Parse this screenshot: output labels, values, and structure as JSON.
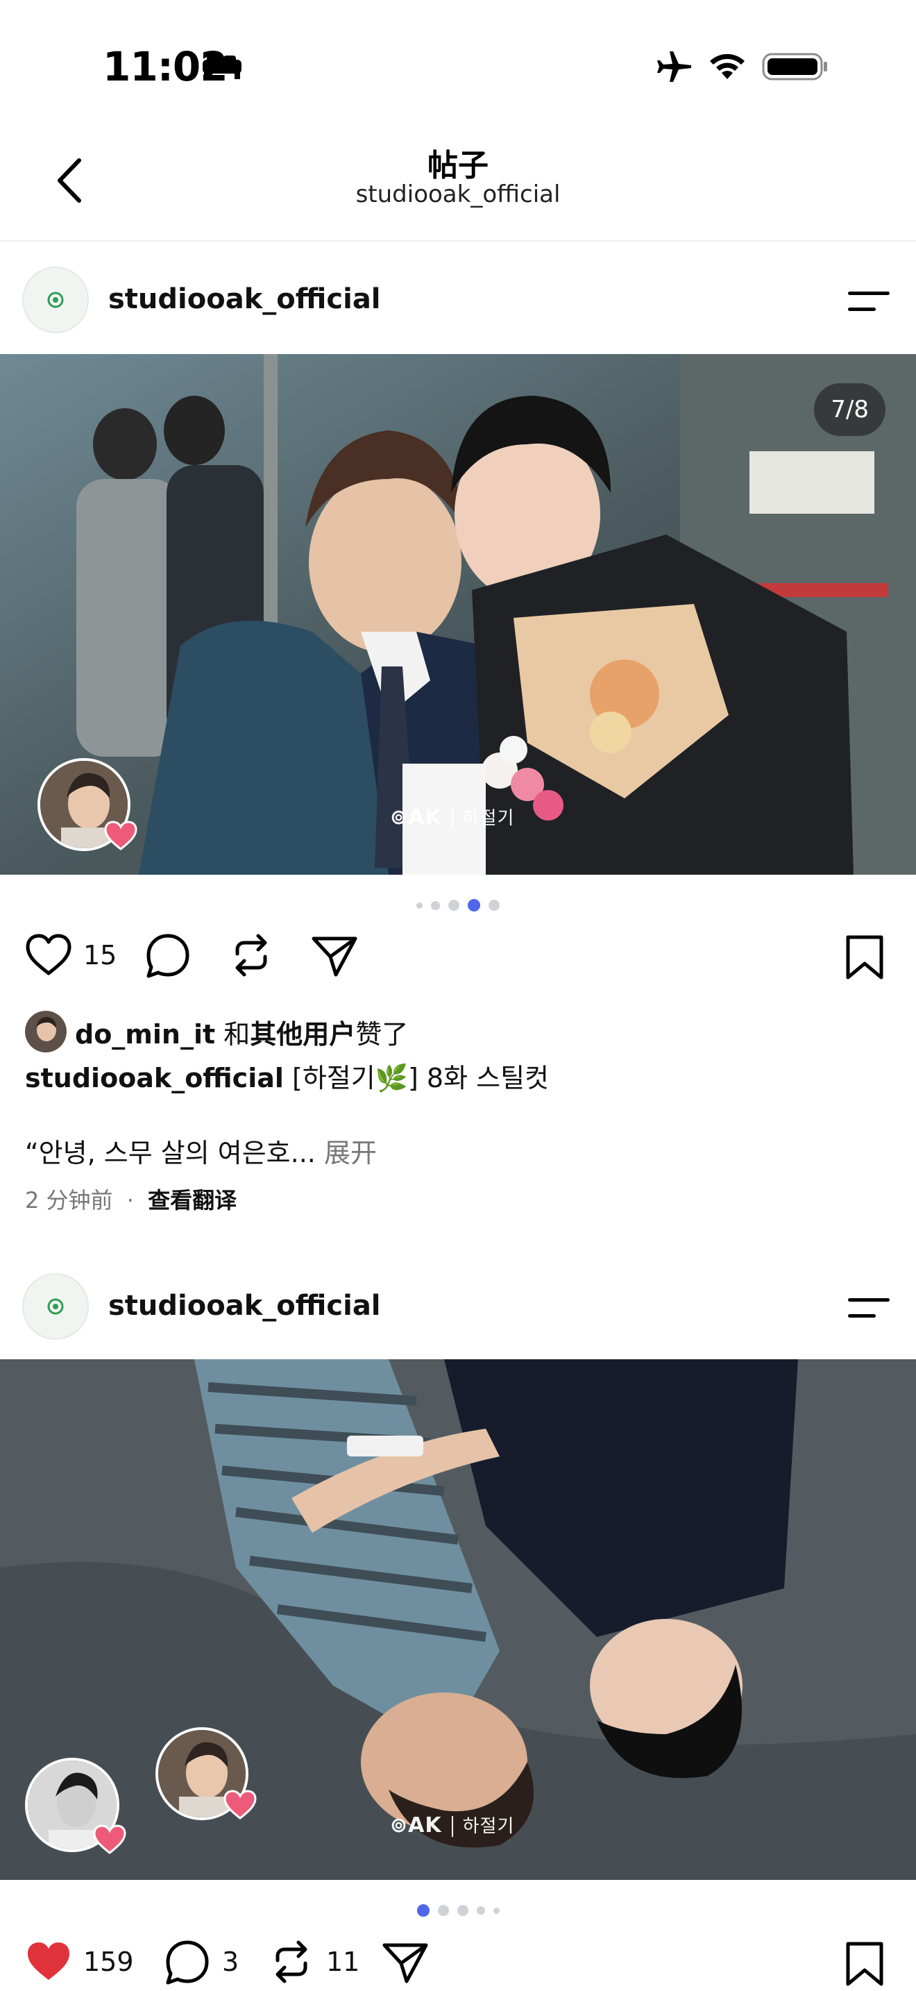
{
  "status_bar": {
    "time": "11:02"
  },
  "header": {
    "title": "帖子",
    "subtitle": "studiooak_official"
  },
  "posts": [
    {
      "username": "studiooak_official",
      "photo_counter": "7/8",
      "watermark_brand": "⊚AK",
      "watermark_title": "하절기",
      "likes_count": "15",
      "liked": false,
      "liked_by_user": "do_min_it",
      "liked_by_joiner": "和",
      "liked_by_others": "其他用户",
      "liked_by_suffix": "赞了",
      "caption_text": "[하절기🌿] 8화 스틸컷",
      "caption_line2": "“안녕, 스무 살의 여은호...",
      "expand_label": "展开",
      "time_ago": "2 分钟前",
      "separator": "·",
      "translate_label": "查看翻译"
    },
    {
      "username": "studiooak_official",
      "watermark_brand": "⊚AK",
      "watermark_title": "하절기",
      "likes_count": "159",
      "liked": true,
      "comments_count": "3",
      "reposts_count": "11"
    }
  ],
  "colors": {
    "accent_dot": "#4f67e8",
    "like_red": "#e0323a",
    "logo_green": "#2f9d57"
  }
}
